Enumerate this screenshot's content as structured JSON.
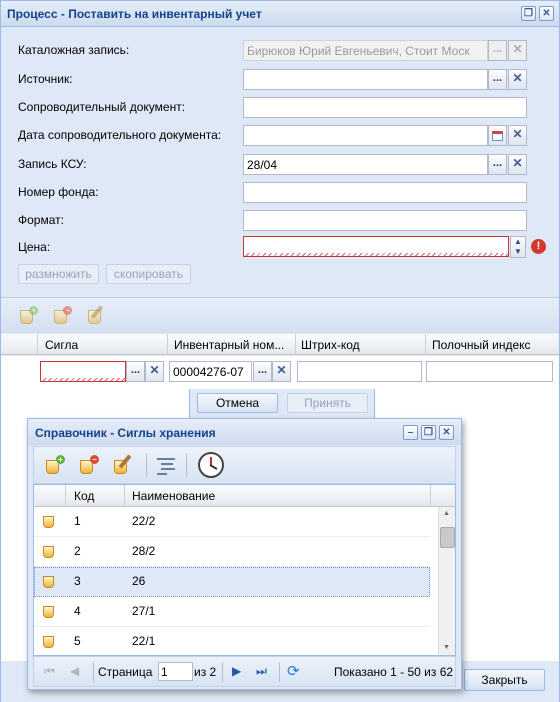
{
  "window": {
    "title": "Процесс - Поставить на инвентарный учет",
    "tools": [
      "❐",
      "✕"
    ]
  },
  "form": {
    "catalog_label": "Каталожная запись:",
    "catalog_value": "Бирюков Юрий Евгеньевич, Стоит Моск",
    "source_label": "Источник:",
    "source_value": "",
    "accomp_doc_label": "Сопроводительный документ:",
    "accomp_doc_value": "",
    "accomp_date_label": "Дата сопроводительного документа:",
    "accomp_date_value": "",
    "ksu_label": "Запись КСУ:",
    "ksu_value": "28/04",
    "fund_label": "Номер фонда:",
    "fund_value": "",
    "format_label": "Формат:",
    "format_value": "",
    "price_label": "Цена:",
    "price_value": "",
    "multiply_button": "размножить",
    "copy_button": "скопировать"
  },
  "grid": {
    "columns": [
      "Сигла",
      "Инвентарный ном...",
      "Штрих-код",
      "Полочный индекс"
    ],
    "row": {
      "sigla": "",
      "inventory": "00004276-07",
      "barcode": "",
      "shelf": ""
    }
  },
  "editor_buttons": {
    "cancel": "Отмена",
    "accept": "Принять"
  },
  "close_button": "Закрыть",
  "dialog": {
    "title": "Справочник - Сиглы хранения",
    "columns": [
      "Код",
      "Наименование"
    ],
    "rows": [
      {
        "code": "1",
        "name": "22/2"
      },
      {
        "code": "2",
        "name": "28/2"
      },
      {
        "code": "3",
        "name": "26"
      },
      {
        "code": "4",
        "name": "27/1"
      },
      {
        "code": "5",
        "name": "22/1"
      }
    ],
    "pager": {
      "page_label": "Страница",
      "page_value": "1",
      "of_label": "из 2",
      "summary": "Показано 1 - 50 из 62"
    }
  },
  "colors": {
    "accent": "#15428b",
    "panel": "#dfe8f6",
    "error": "#cc3333"
  }
}
